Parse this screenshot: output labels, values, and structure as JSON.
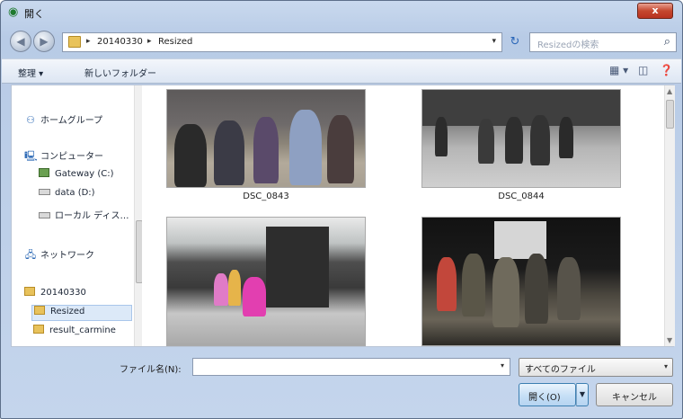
{
  "window": {
    "title": "開く",
    "close_label": "x"
  },
  "navigation": {
    "breadcrumbs": [
      "20140330",
      "Resized"
    ],
    "search_placeholder": "Resizedの検索",
    "refresh_icon": "refresh-icon"
  },
  "toolbar": {
    "organize_label": "整理 ▾",
    "new_folder_label": "新しいフォルダー"
  },
  "sidebar": {
    "items": [
      {
        "label": "ホームグループ",
        "icon": "homegroup-icon"
      },
      {
        "label": "コンピューター",
        "icon": "computer-icon"
      },
      {
        "label": "Gateway (C:)",
        "icon": "drive-icon"
      },
      {
        "label": "data (D:)",
        "icon": "drive-icon"
      },
      {
        "label": "ローカル ディス…",
        "icon": "drive-icon"
      },
      {
        "label": "ネットワーク",
        "icon": "network-icon"
      },
      {
        "label": "20140330",
        "icon": "folder-icon"
      },
      {
        "label": "Resized",
        "icon": "folder-icon",
        "selected": true
      },
      {
        "label": "result_carmine",
        "icon": "folder-icon"
      }
    ]
  },
  "files": [
    {
      "name": "DSC_0843"
    },
    {
      "name": "DSC_0844"
    },
    {
      "name": ""
    },
    {
      "name": ""
    }
  ],
  "footer": {
    "filename_label": "ファイル名(N):",
    "filename_value": "",
    "filter_value": "すべてのファイル",
    "open_label": "開く(O)",
    "cancel_label": "キャンセル"
  }
}
